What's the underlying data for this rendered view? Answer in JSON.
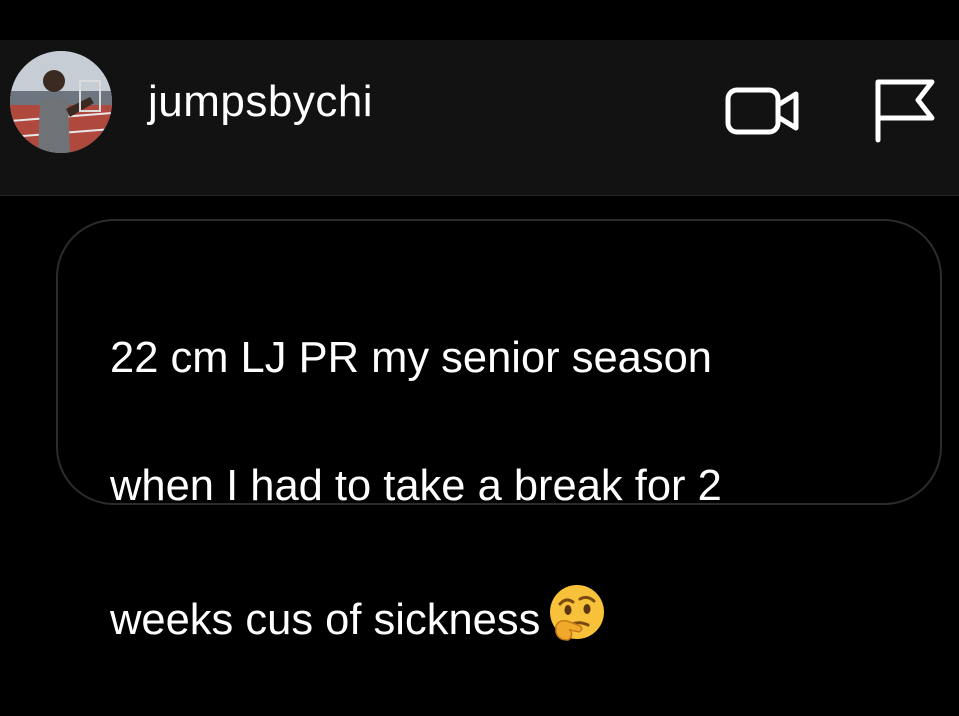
{
  "header": {
    "username": "jumpsbychi",
    "avatar_alt": "profile photo",
    "video_icon": "video-camera-icon",
    "report_icon": "flag-icon"
  },
  "message": {
    "line1": "22 cm LJ PR my senior season",
    "line2": "when I had to take a break for 2",
    "line3": "weeks cus of sickness",
    "emoji_icon": "thinking-face-emoji-icon"
  },
  "colors": {
    "background": "#000000",
    "header_bg": "#121212",
    "bubble_border": "#2c2c2c",
    "text": "#ffffff"
  }
}
